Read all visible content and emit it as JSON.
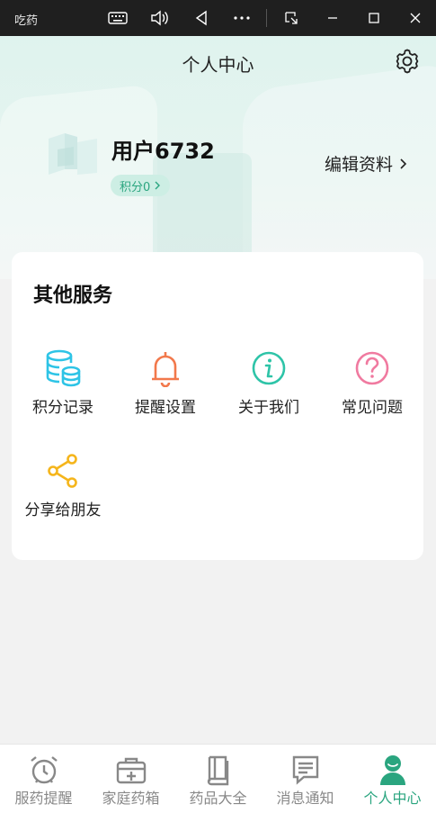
{
  "window": {
    "title": "吃药"
  },
  "header": {
    "title": "个人中心"
  },
  "profile": {
    "username": "用户6732",
    "points_label": "积分0",
    "edit_label": "编辑资料"
  },
  "services": {
    "title": "其他服务",
    "items": [
      {
        "label": "积分记录",
        "icon": "coins-stack-icon",
        "color": "#2ec4e6"
      },
      {
        "label": "提醒设置",
        "icon": "bell-icon",
        "color": "#f2784b"
      },
      {
        "label": "关于我们",
        "icon": "info-icon",
        "color": "#2ec4a8"
      },
      {
        "label": "常见问题",
        "icon": "question-icon",
        "color": "#f07aa0"
      },
      {
        "label": "分享给朋友",
        "icon": "share-icon",
        "color": "#f5b51b"
      }
    ]
  },
  "nav": {
    "items": [
      {
        "label": "服药提醒",
        "icon": "alarm-clock-icon",
        "active": false
      },
      {
        "label": "家庭药箱",
        "icon": "medicine-box-icon",
        "active": false
      },
      {
        "label": "药品大全",
        "icon": "book-icon",
        "active": false
      },
      {
        "label": "消息通知",
        "icon": "message-icon",
        "active": false
      },
      {
        "label": "个人中心",
        "icon": "user-icon",
        "active": true
      }
    ]
  },
  "colors": {
    "accent": "#2aa57f",
    "inactive": "#888888"
  }
}
